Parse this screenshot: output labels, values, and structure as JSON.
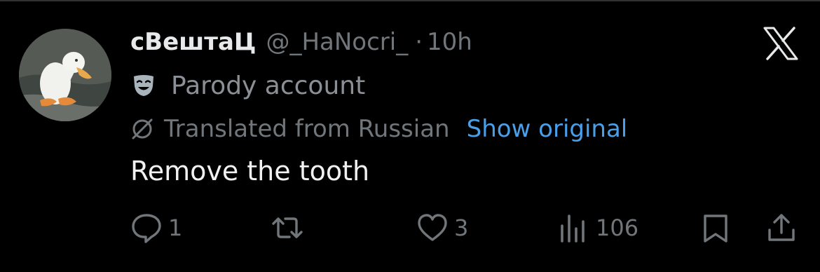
{
  "tweet": {
    "display_name": "сВештаЦ",
    "handle": "@_HaNocri_",
    "separator": "·",
    "time": "10h",
    "label": "Parody account",
    "translation_note": "Translated from Russian",
    "show_original": "Show original",
    "text": "Remove the tooth"
  },
  "actions": {
    "reply_count": "1",
    "retweet_count": "",
    "like_count": "3",
    "views_count": "106"
  },
  "icons": {
    "brand": "x-logo-icon",
    "label": "theater-mask-icon",
    "translate": "no-language-icon",
    "reply": "reply-icon",
    "retweet": "retweet-icon",
    "like": "heart-icon",
    "views": "views-icon",
    "bookmark": "bookmark-icon",
    "share": "share-icon"
  },
  "colors": {
    "background": "#000000",
    "text": "#e7e9ea",
    "secondary": "#71767b",
    "link": "#4a9fe8"
  }
}
